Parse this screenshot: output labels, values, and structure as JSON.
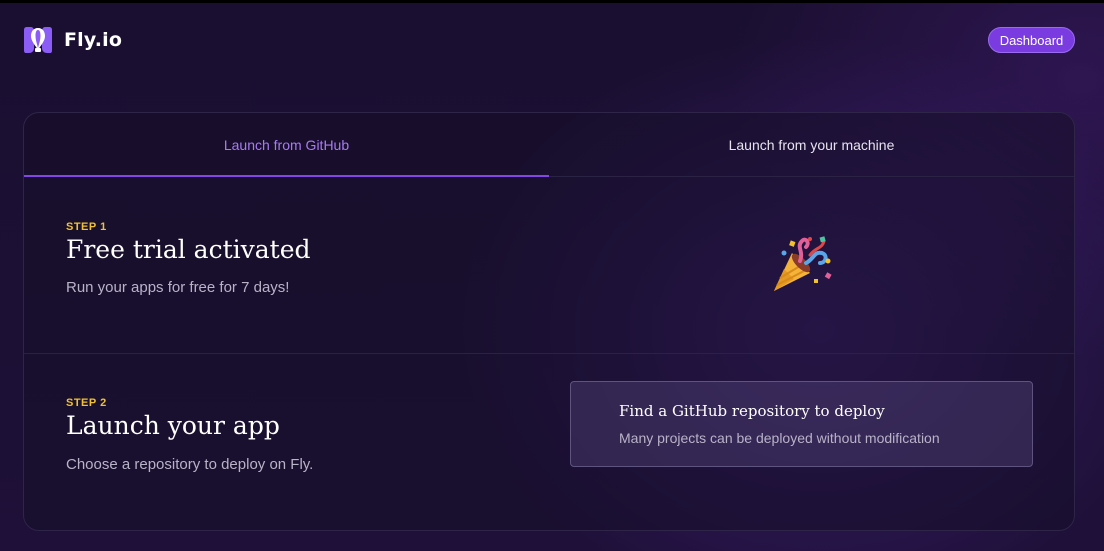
{
  "header": {
    "brand": "Fly.io",
    "logo_icon": "fly-balloon-icon",
    "dashboard_label": "Dashboard"
  },
  "tabs": [
    {
      "label": "Launch from GitHub",
      "active": true
    },
    {
      "label": "Launch from your machine",
      "active": false
    }
  ],
  "steps": [
    {
      "label": "STEP 1",
      "title": "Free trial activated",
      "description": "Run your apps for free for 7 days!",
      "icon": "party-popper-icon"
    },
    {
      "label": "STEP 2",
      "title": "Launch your app",
      "description": "Choose a repository to deploy on Fly.",
      "action": {
        "title": "Find a GitHub repository to deploy",
        "subtitle": "Many projects can be deployed without modification"
      }
    }
  ],
  "colors": {
    "accent": "#8446e6",
    "button": "#7a3be0",
    "step_label": "#f2c12e",
    "background": "#1a0f30"
  }
}
